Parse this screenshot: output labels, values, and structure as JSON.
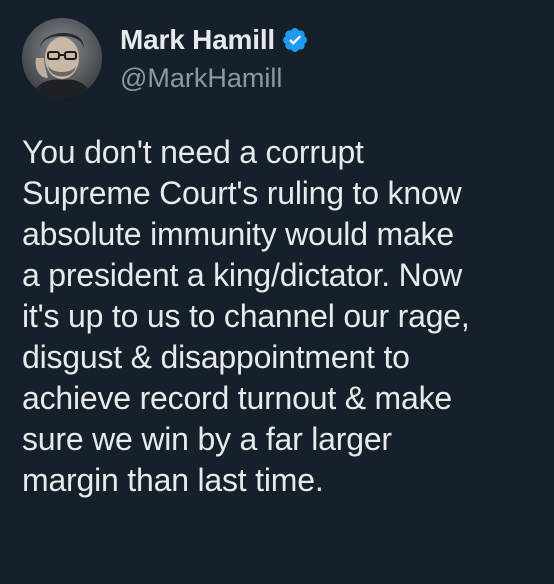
{
  "tweet": {
    "author": {
      "display_name": "Mark Hamill",
      "handle": "@MarkHamill",
      "verified": true,
      "avatar_icon": "profile-photo",
      "verified_icon": "verified-badge-icon"
    },
    "text": "You don't need a corrupt\nSupreme Court's ruling to know\nabsolute immunity would make\na president a king/dictator. Now\nit's up to us to channel our rage,\ndisgust & disappointment to\nachieve record turnout & make\nsure we win by a far larger\nmargin than last time."
  },
  "colors": {
    "background": "#15202b",
    "primary_text": "#e7e9ea",
    "secondary_text": "#8b98a5",
    "verified_blue": "#1d9bf0"
  }
}
